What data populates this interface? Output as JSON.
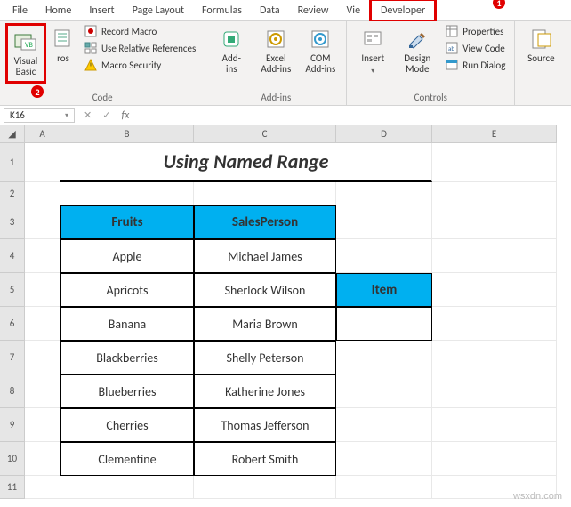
{
  "tabs": [
    "File",
    "Home",
    "Insert",
    "Page Layout",
    "Formulas",
    "Data",
    "Review",
    "Vie",
    "Developer"
  ],
  "callouts": {
    "b1": "1",
    "b2": "2"
  },
  "ribbon": {
    "code": {
      "vb": "Visual\nBasic",
      "macros": "ros",
      "record": "Record Macro",
      "relref": "Use Relative References",
      "security": "Macro Security",
      "label": "Code"
    },
    "addins": {
      "addins": "Add-\nins",
      "excel": "Excel\nAdd-ins",
      "com": "COM\nAdd-ins",
      "label": "Add-ins"
    },
    "controls": {
      "insert": "Insert",
      "design": "Design\nMode",
      "props": "Properties",
      "viewcode": "View Code",
      "rundlg": "Run Dialog",
      "label": "Controls"
    },
    "xml": {
      "source": "Source"
    }
  },
  "namebox": "K16",
  "fx": "fx",
  "columns": [
    "A",
    "B",
    "C",
    "D",
    "E"
  ],
  "title": "Using Named Range",
  "table": {
    "headers": [
      "Fruits",
      "SalesPerson"
    ],
    "rows": [
      [
        "Apple",
        "Michael James"
      ],
      [
        "Apricots",
        "Sherlock Wilson"
      ],
      [
        "Banana",
        "Maria Brown"
      ],
      [
        "Blackberries",
        "Shelly Peterson"
      ],
      [
        "Blueberries",
        "Katherine Jones"
      ],
      [
        "Cherries",
        "Thomas Jefferson"
      ],
      [
        "Clementine",
        "Robert Smith"
      ]
    ]
  },
  "side_header": "Item",
  "row_numbers": [
    "1",
    "2",
    "3",
    "4",
    "5",
    "6",
    "7",
    "8",
    "9",
    "10",
    "11"
  ],
  "watermark": "wsxdn.com"
}
